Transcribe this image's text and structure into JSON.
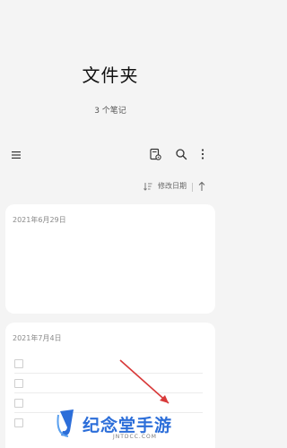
{
  "header": {
    "title": "文件夹",
    "subtitle": "3 个笔记"
  },
  "toolbar": {
    "menu_icon": "hamburger-menu-icon",
    "note_icon": "notebook-settings-icon",
    "search_icon": "search-icon",
    "more_icon": "more-vertical-icon"
  },
  "sortbar": {
    "sort_icon": "sort-icon",
    "label": "修改日期",
    "direction_icon": "arrow-up-icon"
  },
  "notes": [
    {
      "date": "2021年6月29日"
    },
    {
      "date": "2021年7月4日",
      "checklist_items": 4
    }
  ],
  "watermark": {
    "title": "纪念堂手游",
    "subtitle": "JNTDCC.COM"
  },
  "colors": {
    "background": "#f4f4f4",
    "card": "#ffffff",
    "annotation_arrow": "#d83a3a",
    "watermark_blue": "#2c6ed9"
  }
}
